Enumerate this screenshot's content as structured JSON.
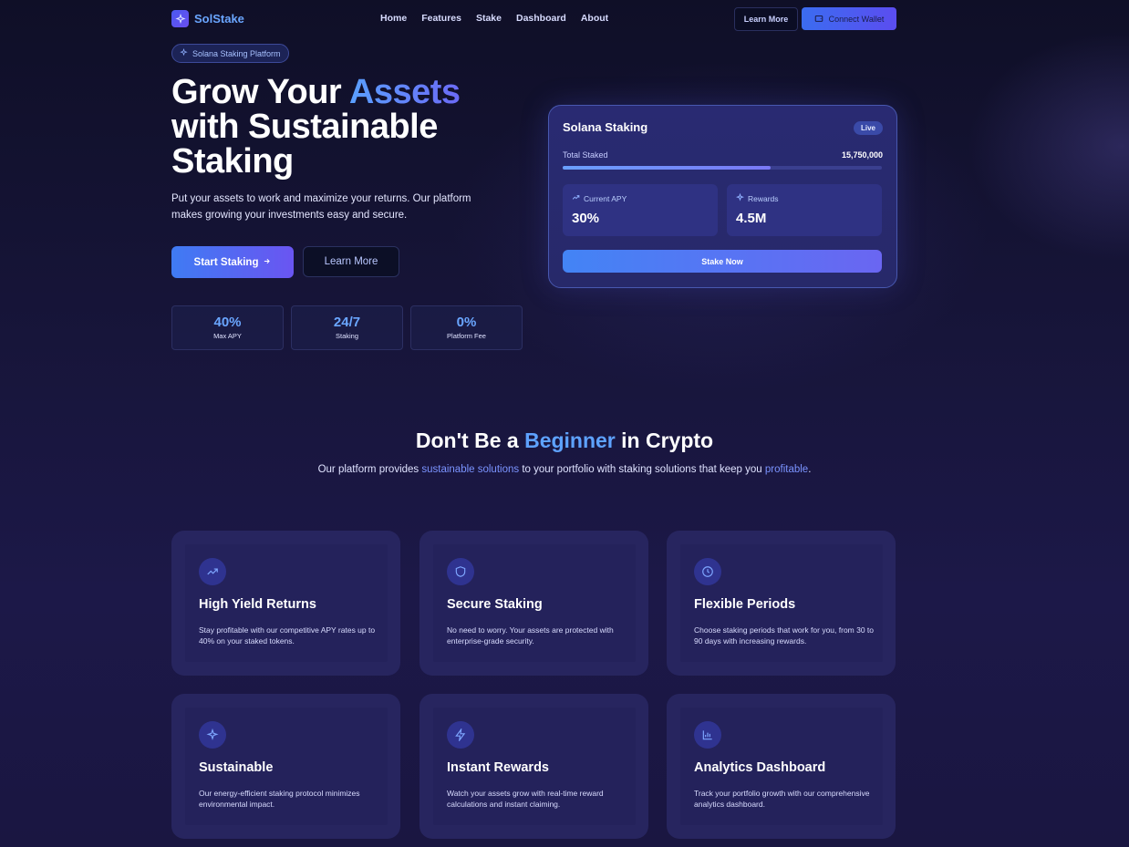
{
  "nav": {
    "brand": "SolStake",
    "links": [
      "Home",
      "Features",
      "Stake",
      "Dashboard",
      "About"
    ],
    "learn_more": "Learn More",
    "connect_wallet": "Connect Wallet"
  },
  "hero": {
    "badge": "Solana Staking Platform",
    "title_part1": "Grow Your ",
    "title_accent": "Assets",
    "title_part2": "with Sustainable Staking",
    "subtitle": "Put your assets to work and maximize your returns. Our platform makes growing your investments easy and secure.",
    "start_button": "Start Staking",
    "learn_button": "Learn More",
    "stats": [
      {
        "value": "40%",
        "label": "Max APY"
      },
      {
        "value": "24/7",
        "label": "Staking"
      },
      {
        "value": "0%",
        "label": "Platform Fee"
      }
    ]
  },
  "stake_card": {
    "title": "Solana Staking",
    "status": "Live",
    "total_staked_label": "Total Staked",
    "total_staked_value": "15,750,000",
    "progress_fraction": 0.65,
    "apy_label": "Current APY",
    "apy_value": "30%",
    "rewards_label": "Rewards",
    "rewards_value": "4.5M",
    "stake_button": "Stake Now"
  },
  "features_section": {
    "title_part1": "Don't Be a ",
    "title_accent": "Beginner",
    "title_part2": " in Crypto",
    "subtitle_part1": "Our platform provides ",
    "subtitle_hl1": "sustainable solutions",
    "subtitle_part2": " to your portfolio with staking solutions that keep you ",
    "subtitle_hl2": "profitable",
    "subtitle_part3": ".",
    "cards": [
      {
        "icon": "trending-up-icon",
        "title": "High Yield Returns",
        "desc": "Stay profitable with our competitive APY rates up to 40% on your staked tokens."
      },
      {
        "icon": "shield-icon",
        "title": "Secure Staking",
        "desc": "No need to worry. Your assets are protected with enterprise-grade security."
      },
      {
        "icon": "clock-icon",
        "title": "Flexible Periods",
        "desc": "Choose staking periods that work for you, from 30 to 90 days with increasing rewards."
      },
      {
        "icon": "sparkles-icon",
        "title": "Sustainable",
        "desc": "Our energy-efficient staking protocol minimizes environmental impact."
      },
      {
        "icon": "zap-icon",
        "title": "Instant Rewards",
        "desc": "Watch your assets grow with real-time reward calculations and instant claiming."
      },
      {
        "icon": "bar-chart-icon",
        "title": "Analytics Dashboard",
        "desc": "Track your portfolio growth with our comprehensive analytics dashboard."
      }
    ]
  },
  "colors": {
    "background": "#15132e",
    "accent_blue": "#5ea2ff",
    "accent_purple": "#6a55f2",
    "card": "#27255f"
  }
}
